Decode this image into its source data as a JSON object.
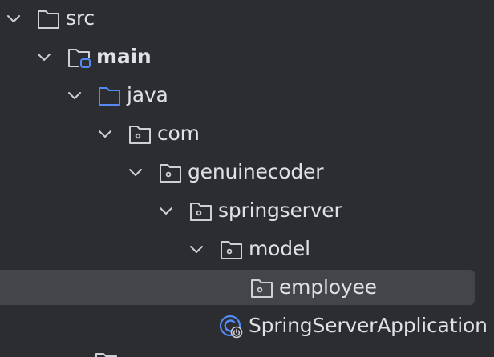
{
  "project_tree": {
    "nodes": [
      {
        "label": "src",
        "state": "expanded",
        "icon": "folder-icon"
      },
      {
        "label": "main",
        "state": "expanded",
        "icon": "source-root-folder-icon"
      },
      {
        "label": "java",
        "state": "expanded",
        "icon": "java-source-folder-icon"
      },
      {
        "label": "com",
        "state": "expanded",
        "icon": "package-icon"
      },
      {
        "label": "genuinecoder",
        "state": "expanded",
        "icon": "package-icon"
      },
      {
        "label": "springserver",
        "state": "expanded",
        "icon": "package-icon"
      },
      {
        "label": "model",
        "state": "expanded",
        "icon": "package-icon"
      },
      {
        "label": "employee",
        "state": "leaf",
        "icon": "package-icon",
        "selected": true
      },
      {
        "label": "SpringServerApplication",
        "state": "leaf",
        "icon": "spring-boot-class-icon"
      }
    ]
  },
  "colors": {
    "background": "#2b2d30",
    "selection": "#43454a",
    "text": "#dfe1e5",
    "icon_stroke": "#ced0d6",
    "java_folder": "#548af7",
    "class_icon": "#548af7"
  }
}
